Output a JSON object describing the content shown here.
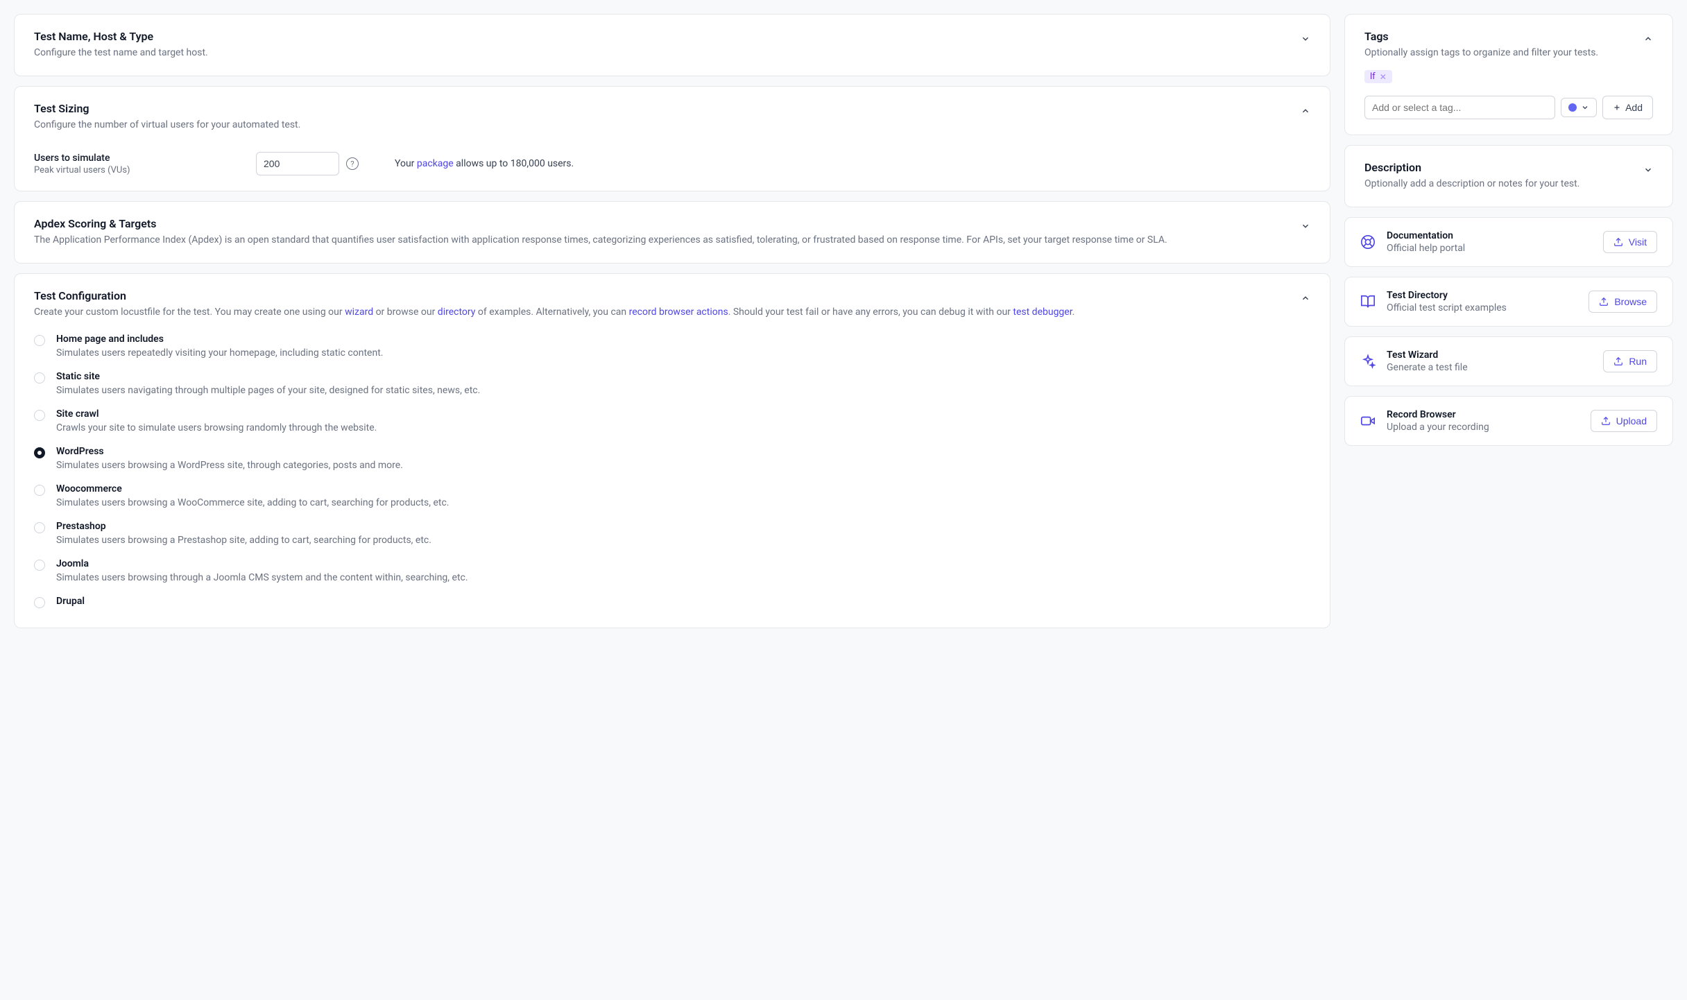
{
  "sections": {
    "name": {
      "title": "Test Name, Host & Type",
      "sub": "Configure the test name and target host."
    },
    "sizing": {
      "title": "Test Sizing",
      "sub": "Configure the number of virtual users for your automated test.",
      "users_label": "Users to simulate",
      "users_sub": "Peak virtual users (VUs)",
      "users_value": "200",
      "pkg_pre": "Your ",
      "pkg_link": "package",
      "pkg_post": " allows up to 180,000 users."
    },
    "apdex": {
      "title": "Apdex Scoring & Targets",
      "sub": "The Application Performance Index (Apdex) is an open standard that quantifies user satisfaction with application response times, categorizing experiences as satisfied, tolerating, or frustrated based on response time. For APIs, set your target response time or SLA."
    },
    "config": {
      "title": "Test Configuration",
      "sub_part1": "Create your custom locustfile for the test. You may create one using our ",
      "link_wizard": "wizard",
      "sub_part2": " or browse our ",
      "link_directory": "directory",
      "sub_part3": " of examples. Alternatively, you can ",
      "link_record": "record browser actions",
      "sub_part4": ". Should your test fail or have any errors, you can debug it with our ",
      "link_debugger": "test debugger",
      "sub_part5": ".",
      "selected": "wordpress",
      "options": [
        {
          "key": "home",
          "label": "Home page and includes",
          "desc": "Simulates users repeatedly visiting your homepage, including static content."
        },
        {
          "key": "static",
          "label": "Static site",
          "desc": "Simulates users navigating through multiple pages of your site, designed for static sites, news, etc."
        },
        {
          "key": "crawl",
          "label": "Site crawl",
          "desc": "Crawls your site to simulate users browsing randomly through the website."
        },
        {
          "key": "wordpress",
          "label": "WordPress",
          "desc": "Simulates users browsing a WordPress site, through categories, posts and more."
        },
        {
          "key": "woo",
          "label": "Woocommerce",
          "desc": "Simulates users browsing a WooCommerce site, adding to cart, searching for products, etc."
        },
        {
          "key": "prestashop",
          "label": "Prestashop",
          "desc": "Simulates users browsing a Prestashop site, adding to cart, searching for products, etc."
        },
        {
          "key": "joomla",
          "label": "Joomla",
          "desc": "Simulates users browsing through a Joomla CMS system and the content within, searching, etc."
        },
        {
          "key": "drupal",
          "label": "Drupal",
          "desc": ""
        }
      ]
    }
  },
  "sidebar": {
    "tags": {
      "title": "Tags",
      "sub": "Optionally assign tags to organize and filter your tests.",
      "chip": "lf",
      "placeholder": "Add or select a tag...",
      "add_label": "Add"
    },
    "description": {
      "title": "Description",
      "sub": "Optionally add a description or notes for your test."
    },
    "items": [
      {
        "title": "Documentation",
        "desc": "Official help portal",
        "btn": "Visit",
        "icon": "life"
      },
      {
        "title": "Test Directory",
        "desc": "Official test script examples",
        "btn": "Browse",
        "icon": "book"
      },
      {
        "title": "Test Wizard",
        "desc": "Generate a test file",
        "btn": "Run",
        "icon": "sparkle"
      },
      {
        "title": "Record Browser",
        "desc": "Upload a your recording",
        "btn": "Upload",
        "icon": "video"
      }
    ]
  }
}
